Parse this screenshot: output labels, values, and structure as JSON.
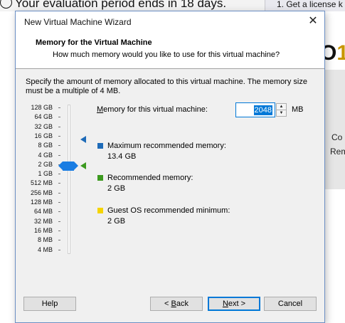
{
  "background": {
    "evaluation_text": "Your evaluation period ends in 18 days.",
    "tab_text": "1. Get a license k",
    "logo_text": "O",
    "logo_number": "1",
    "side_text_1": "Co",
    "side_text_2": "Rem"
  },
  "dialog": {
    "title": "New Virtual Machine Wizard",
    "close_glyph": "✕",
    "header_title": "Memory for the Virtual Machine",
    "header_subtitle": "How much memory would you like to use for this virtual machine?",
    "description": "Specify the amount of memory allocated to this virtual machine. The memory size must be a multiple of 4 MB.",
    "memory_label": "Memory for this virtual machine:",
    "memory_value": "2048",
    "memory_unit": "MB",
    "scale_labels": [
      "128 GB",
      "64 GB",
      "32 GB",
      "16 GB",
      "8 GB",
      "4 GB",
      "2 GB",
      "1 GB",
      "512 MB",
      "256 MB",
      "128 MB",
      "64 MB",
      "32 MB",
      "16 MB",
      "8 MB",
      "4 MB"
    ],
    "legend": {
      "max_title": "Maximum recommended memory:",
      "max_value": "13.4 GB",
      "rec_title": "Recommended memory:",
      "rec_value": "2 GB",
      "min_title": "Guest OS recommended minimum:",
      "min_value": "2 GB"
    },
    "colors": {
      "max": "#1e6bb8",
      "rec": "#3c9a1f",
      "min": "#f5d400",
      "accent": "#0078d7"
    },
    "buttons": {
      "help": "Help",
      "back_prefix": "< ",
      "back_hotkey": "B",
      "back_rest": "ack",
      "next_hotkey": "N",
      "next_rest": "ext >",
      "cancel": "Cancel"
    }
  }
}
